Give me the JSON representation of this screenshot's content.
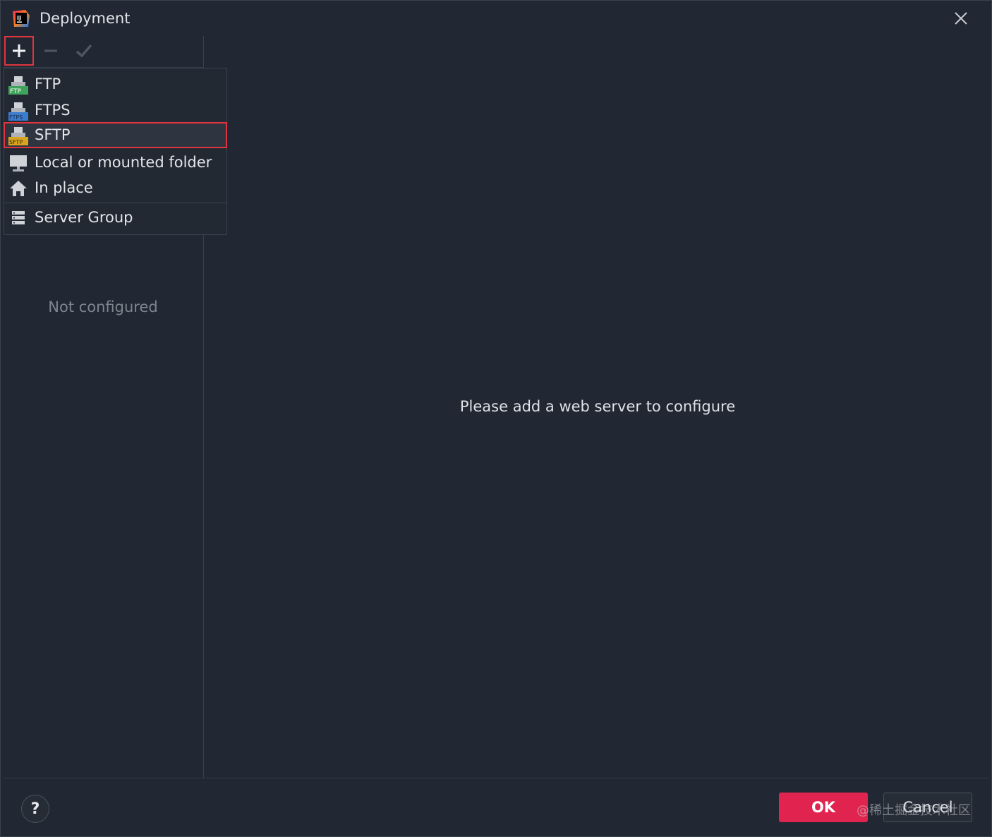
{
  "window": {
    "title": "Deployment"
  },
  "toolbar": {
    "add_icon": "plus-icon",
    "remove_icon": "minus-icon",
    "apply_icon": "check-icon"
  },
  "add_menu": {
    "items": [
      {
        "label": "FTP",
        "icon": "ftp-icon",
        "badge": "FTP",
        "badge_color": "#3fa35a"
      },
      {
        "label": "FTPS",
        "icon": "ftps-icon",
        "badge": "FTPS",
        "badge_color": "#3b7ccf"
      },
      {
        "label": "SFTP",
        "icon": "sftp-icon",
        "badge": "SFTP",
        "badge_color": "#d9a520",
        "selected": true
      },
      {
        "label": "Local or mounted folder",
        "icon": "monitor-icon"
      },
      {
        "label": "In place",
        "icon": "home-icon"
      },
      {
        "label": "Server Group",
        "icon": "server-group-icon"
      }
    ]
  },
  "left_panel": {
    "empty_text": "Not configured"
  },
  "main": {
    "placeholder": "Please add a web server to configure"
  },
  "footer": {
    "help_label": "?",
    "ok_label": "OK",
    "cancel_label": "Cancel",
    "watermark": "@稀土掘金技术社区"
  },
  "colors": {
    "accent_red": "#e0353e",
    "ok_button": "#e0244f",
    "background": "#212833"
  }
}
